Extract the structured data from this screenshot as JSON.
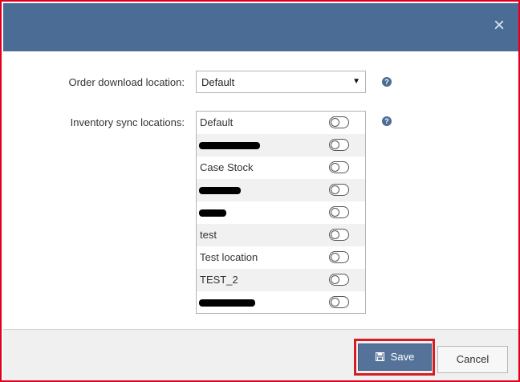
{
  "header": {
    "close_glyph": "×"
  },
  "form": {
    "order_label": "Order download location:",
    "order_value": "Default",
    "inventory_label": "Inventory sync locations:",
    "help_glyph": "?"
  },
  "locations": [
    {
      "label": "Default",
      "redacted": false
    },
    {
      "label": "",
      "redacted": true
    },
    {
      "label": "Case Stock",
      "redacted": false
    },
    {
      "label": "",
      "redacted": true
    },
    {
      "label": "",
      "redacted": true
    },
    {
      "label": "test",
      "redacted": false
    },
    {
      "label": "Test location",
      "redacted": false
    },
    {
      "label": "TEST_2",
      "redacted": false
    },
    {
      "label": "",
      "redacted": true
    }
  ],
  "footer": {
    "save_label": "Save",
    "cancel_label": "Cancel"
  },
  "colors": {
    "header": "#4a6c95",
    "primary_button": "#557399",
    "highlight": "#d81c24"
  }
}
